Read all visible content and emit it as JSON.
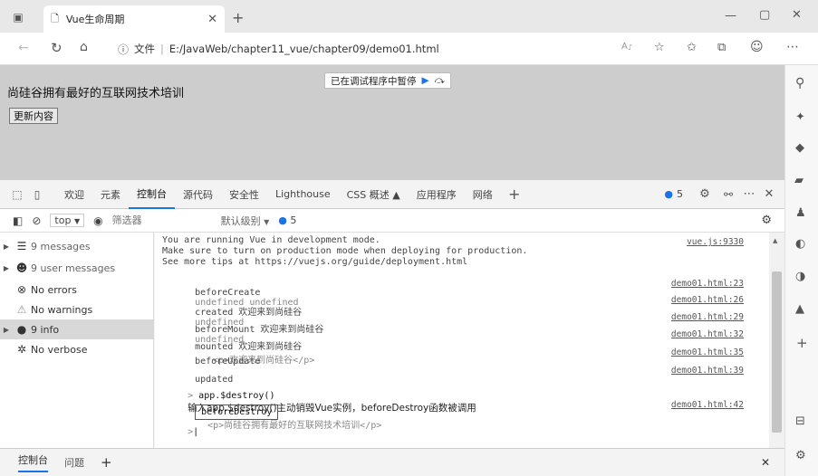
{
  "browser": {
    "tab_title": "Vue生命周期",
    "address_info": "文件",
    "address_url": "E:/JavaWeb/chapter11_vue/chapter09/demo01.html"
  },
  "page": {
    "heading": "尚硅谷拥有最好的互联网技术培训",
    "button_label": "更新内容",
    "paused_label": "已在调试程序中暂停"
  },
  "devtools": {
    "tabs": [
      "欢迎",
      "元素",
      "控制台",
      "源代码",
      "安全性",
      "Lighthouse",
      "CSS 概述 ▲",
      "应用程序",
      "网络"
    ],
    "active_tab": "控制台",
    "issue_count": "5",
    "filter": {
      "context": "top",
      "placeholder": "筛选器",
      "level": "默认级别",
      "issues": "5"
    },
    "sidebar": [
      {
        "label": "9 messages",
        "icon": "list-icon"
      },
      {
        "label": "9 user messages",
        "icon": "user-icon"
      },
      {
        "label": "No errors",
        "icon": "error-icon"
      },
      {
        "label": "No warnings",
        "icon": "warning-icon"
      },
      {
        "label": "9 info",
        "icon": "info-icon"
      },
      {
        "label": "No verbose",
        "icon": "verbose-icon"
      }
    ],
    "console": {
      "vue_notice": [
        "You are running Vue in development mode.",
        "Make sure to turn on production mode when deploying for production.",
        "See more tips at https://vuejs.org/guide/deployment.html"
      ],
      "vue_src": "vue.js:9330",
      "logs": [
        {
          "text": "beforeCreate",
          "extra": "undefined undefined",
          "src": "demo01.html:23"
        },
        {
          "text": "created 欢迎来到尚硅谷",
          "extra": "undefined",
          "src": "demo01.html:26"
        },
        {
          "text": "beforeMount 欢迎来到尚硅谷",
          "extra": "undefined",
          "src": "demo01.html:29"
        },
        {
          "text": "mounted 欢迎来到尚硅谷",
          "extra": "<p>欢迎来到尚硅谷</p>",
          "src": "demo01.html:32"
        },
        {
          "text": "beforeUpdate",
          "extra": "",
          "src": "demo01.html:35"
        },
        {
          "text": "updated",
          "extra": "",
          "src": "demo01.html:39"
        }
      ],
      "command": "app.$destroy()",
      "command_note": "输入app.$destroy()主动销毁Vue实例，beforeDestroy函数被调用",
      "destroy_label": "beforeDestroy",
      "destroy_extra": "<p>尚硅谷拥有最好的互联网技术培训</p>",
      "destroy_src": "demo01.html:42"
    },
    "drawer": {
      "tab1": "控制台",
      "tab2": "问题"
    }
  },
  "colors": {
    "accent": "#1a73e8",
    "page_bg": "#cdcdcd"
  }
}
